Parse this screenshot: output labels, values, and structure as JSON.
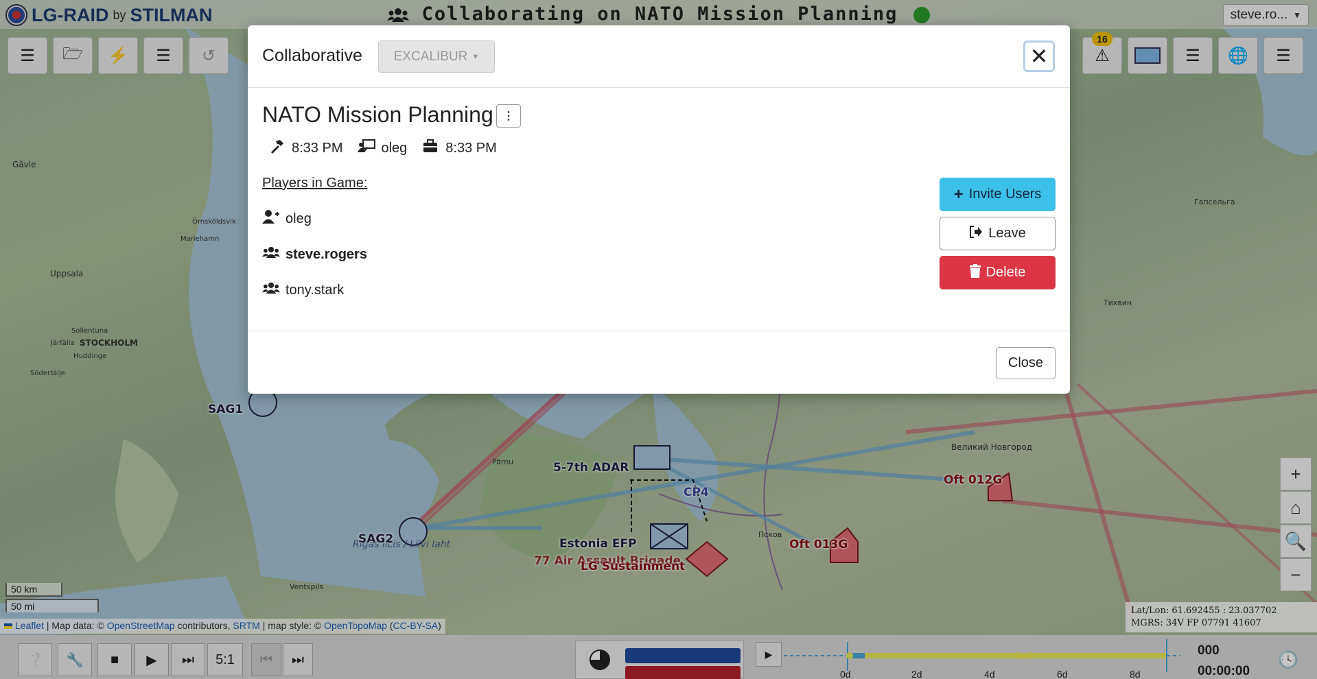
{
  "header": {
    "logo_text": "LG-RAID",
    "logo_by": "by",
    "logo_brand": "STILMAN",
    "session_title": "Collaborating on NATO Mission Planning",
    "user_menu": "steve.ro..."
  },
  "toolbar": {
    "alerts_count": "16"
  },
  "modal": {
    "title": "Collaborative",
    "org_select": "EXCALIBUR",
    "game_name": "NATO Mission Planning",
    "created_time": "8:33 PM",
    "owner": "oleg",
    "modified_time": "8:33 PM",
    "players_heading": "Players in Game:",
    "players": [
      {
        "name": "oleg",
        "current": false
      },
      {
        "name": "steve.rogers",
        "current": true
      },
      {
        "name": "tony.stark",
        "current": false
      }
    ],
    "invite_label": "Invite Users",
    "leave_label": "Leave",
    "delete_label": "Delete",
    "close_label": "Close"
  },
  "map": {
    "places": [
      "Gävle",
      "Uppsala",
      "STOCKHOLM",
      "Örnsköldsvik",
      "Mariehamn",
      "Sollentuna",
      "Järfälla",
      "Huddinge",
      "Södertälje",
      "Pärnu",
      "Великий Новгород",
      "Псков",
      "Гапсельга",
      "Тихвин",
      "Ventspils",
      "Rigas licis / Liivi laht"
    ],
    "units": [
      "SAG1",
      "SAG2",
      "5-7th ADAR",
      "CP4",
      "Estonia EFP",
      "77 Air Assault Brigade",
      "LG Sustainment",
      "Oft 012G",
      "Oft 013G"
    ],
    "scale_km": "50 km",
    "scale_mi": "50 mi",
    "coords_latlon": "Lat/Lon: 61.692455 : 23.037702",
    "coords_mgrs": "MGRS: 34V FP 07791 41607",
    "attribution": {
      "leaflet": "Leaflet",
      "sep1": " | Map data: © ",
      "osm": "OpenStreetMap",
      "contributors": " contributors, ",
      "srtm": "SRTM",
      "style": " | map style: © ",
      "otm": "OpenTopoMap",
      "license": "CC-BY-SA"
    }
  },
  "bottombar": {
    "speed": "5:1",
    "turn": "000",
    "time": "00:00:00",
    "ticks": [
      "0d",
      "2d",
      "4d",
      "6d",
      "8d"
    ]
  }
}
